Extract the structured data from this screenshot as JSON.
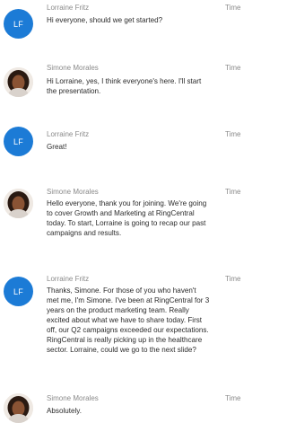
{
  "messages": [
    {
      "initials": "LF",
      "sender": "Lorraine Fritz",
      "time": "Time",
      "text": "Hi everyone, should we get started?"
    },
    {
      "sender": "Simone Morales",
      "time": "Time",
      "text": "Hi Lorraine, yes, I think everyone's here. I'll start\nthe presentation."
    },
    {
      "initials": "LF",
      "sender": "Lorraine Fritz",
      "time": "Time",
      "text": "Great!"
    },
    {
      "sender": "Simone Morales",
      "time": "Time",
      "text": "Hello everyone, thank you for joining. We're going\nto cover Growth and Marketing at RingCentral\ntoday. To start, Lorraine is going to recap our past\ncampaigns and results."
    },
    {
      "initials": "LF",
      "sender": "Lorraine Fritz",
      "time": "Time",
      "text": "Thanks, Simone. For those of you who haven't\nmet me, I'm Simone. I've been at RingCentral for 3\nyears on the product marketing team. Really\nexcited about what we have to share today. First\noff, our Q2 campaigns exceeded our expectations.\nRingCentral is really picking up in the healthcare\nsector. Lorraine, could we go to the next slide?"
    },
    {
      "sender": "Simone Morales",
      "time": "Time",
      "text": "Absolutely."
    }
  ],
  "colors": {
    "initials_avatar_bg": "#1c7bd6",
    "meta_text": "#8a8a8a",
    "body_text": "#2b2b2b"
  }
}
